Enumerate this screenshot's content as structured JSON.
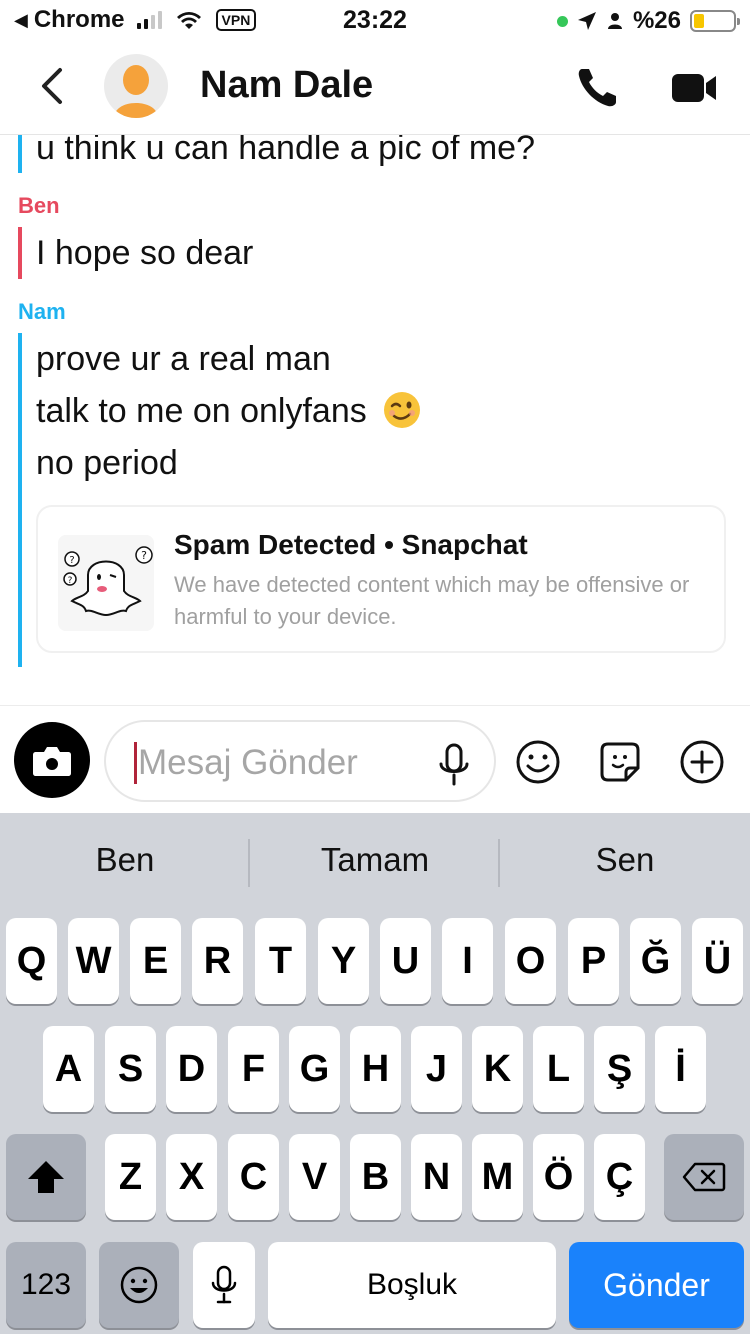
{
  "status_bar": {
    "back_app": "Chrome",
    "vpn": "VPN",
    "time": "23:22",
    "battery": "%26",
    "battery_level": 0.26,
    "accent_green": "#35c759",
    "battery_color": "#f7c600"
  },
  "header": {
    "contact_name": "Nam Dale",
    "icons": [
      "chevron-left-icon",
      "avatar-icon",
      "phone-icon",
      "video-call-icon"
    ]
  },
  "chat": {
    "partial_message": "u think u can handle a pic of me?",
    "messages": [
      {
        "sender": "Ben",
        "color": "#e6495e",
        "lines": [
          "I hope so dear"
        ]
      },
      {
        "sender": "Nam",
        "color": "#1eb2f0",
        "lines": [
          "prove ur a real man",
          "talk to me on onlyfans",
          "no period"
        ]
      }
    ],
    "spam_card": {
      "title": "Spam Detected • Snapchat",
      "description": "We have detected content which may be offensive or harmful to your device."
    }
  },
  "composer": {
    "placeholder": "Mesaj Gönder",
    "icons": [
      "camera-icon",
      "microphone-icon",
      "smiley-icon",
      "sticker-icon",
      "plus-icon"
    ]
  },
  "keyboard": {
    "suggestions": [
      "Ben",
      "Tamam",
      "Sen"
    ],
    "row1": [
      "Q",
      "W",
      "E",
      "R",
      "T",
      "Y",
      "U",
      "I",
      "O",
      "P",
      "Ğ",
      "Ü"
    ],
    "row2": [
      "A",
      "S",
      "D",
      "F",
      "G",
      "H",
      "J",
      "K",
      "L",
      "Ş",
      "İ"
    ],
    "row3": [
      "Z",
      "X",
      "C",
      "V",
      "B",
      "N",
      "M",
      "Ö",
      "Ç"
    ],
    "numbers_key": "123",
    "space_key": "Boşluk",
    "send_key": "Gönder",
    "send_color": "#1a82fb"
  }
}
